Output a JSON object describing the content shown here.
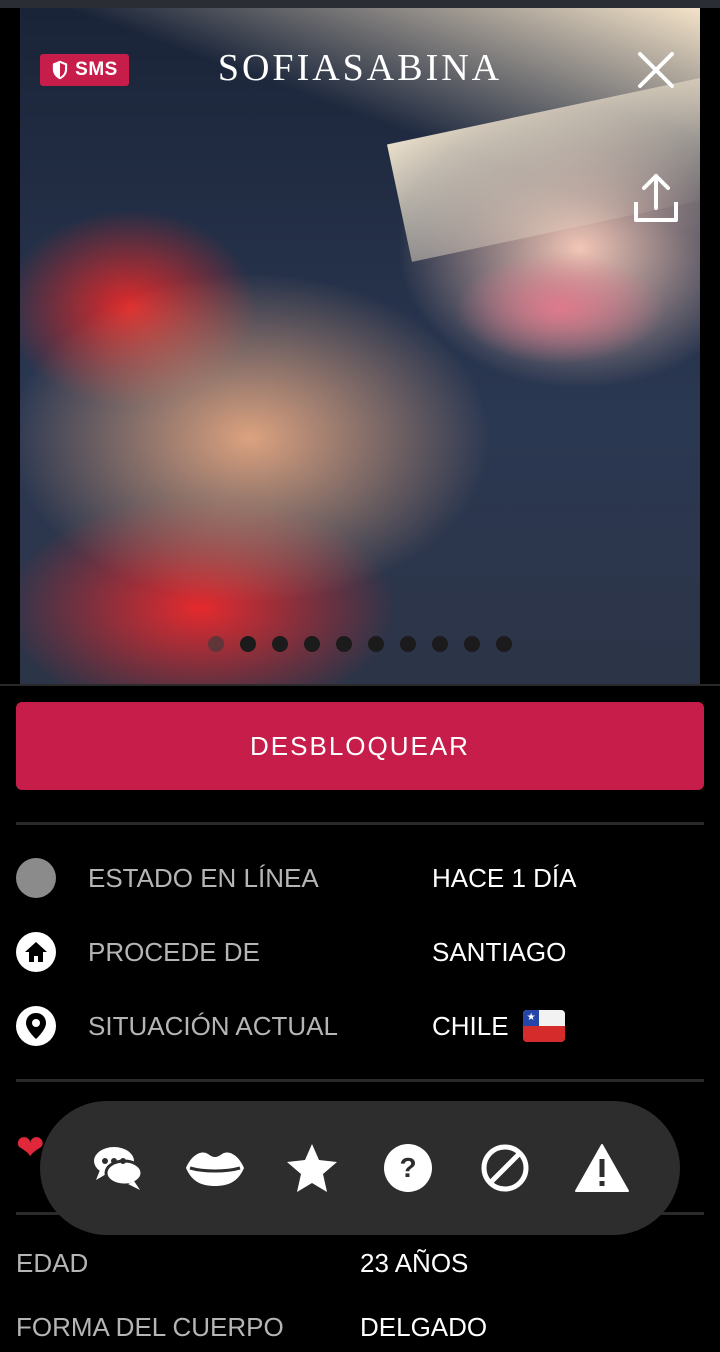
{
  "header": {
    "sms_badge": "SMS",
    "profile_name": "SOFIASABINA"
  },
  "gallery": {
    "total_photos": 10,
    "active_index": 0
  },
  "unlock_button": "DESBLOQUEAR",
  "info": [
    {
      "icon": "status-dot-icon",
      "label": "ESTADO EN LÍNEA",
      "value": "HACE 1 DÍA"
    },
    {
      "icon": "home-icon",
      "label": "PROCEDE DE",
      "value": "SANTIAGO"
    },
    {
      "icon": "location-pin-icon",
      "label": "SITUACIÓN ACTUAL",
      "value": "CHILE"
    }
  ],
  "action_bar": [
    "chat-icon",
    "kiss-icon",
    "star-icon",
    "question-icon",
    "block-icon",
    "warning-icon"
  ],
  "details": [
    {
      "label": "EDAD",
      "value": "23 AÑOS"
    },
    {
      "label": "FORMA DEL CUERPO",
      "value": "DELGADO"
    }
  ],
  "colors": {
    "accent": "#c71d4b",
    "background": "#000000",
    "action_bar": "#2d2d2d"
  }
}
